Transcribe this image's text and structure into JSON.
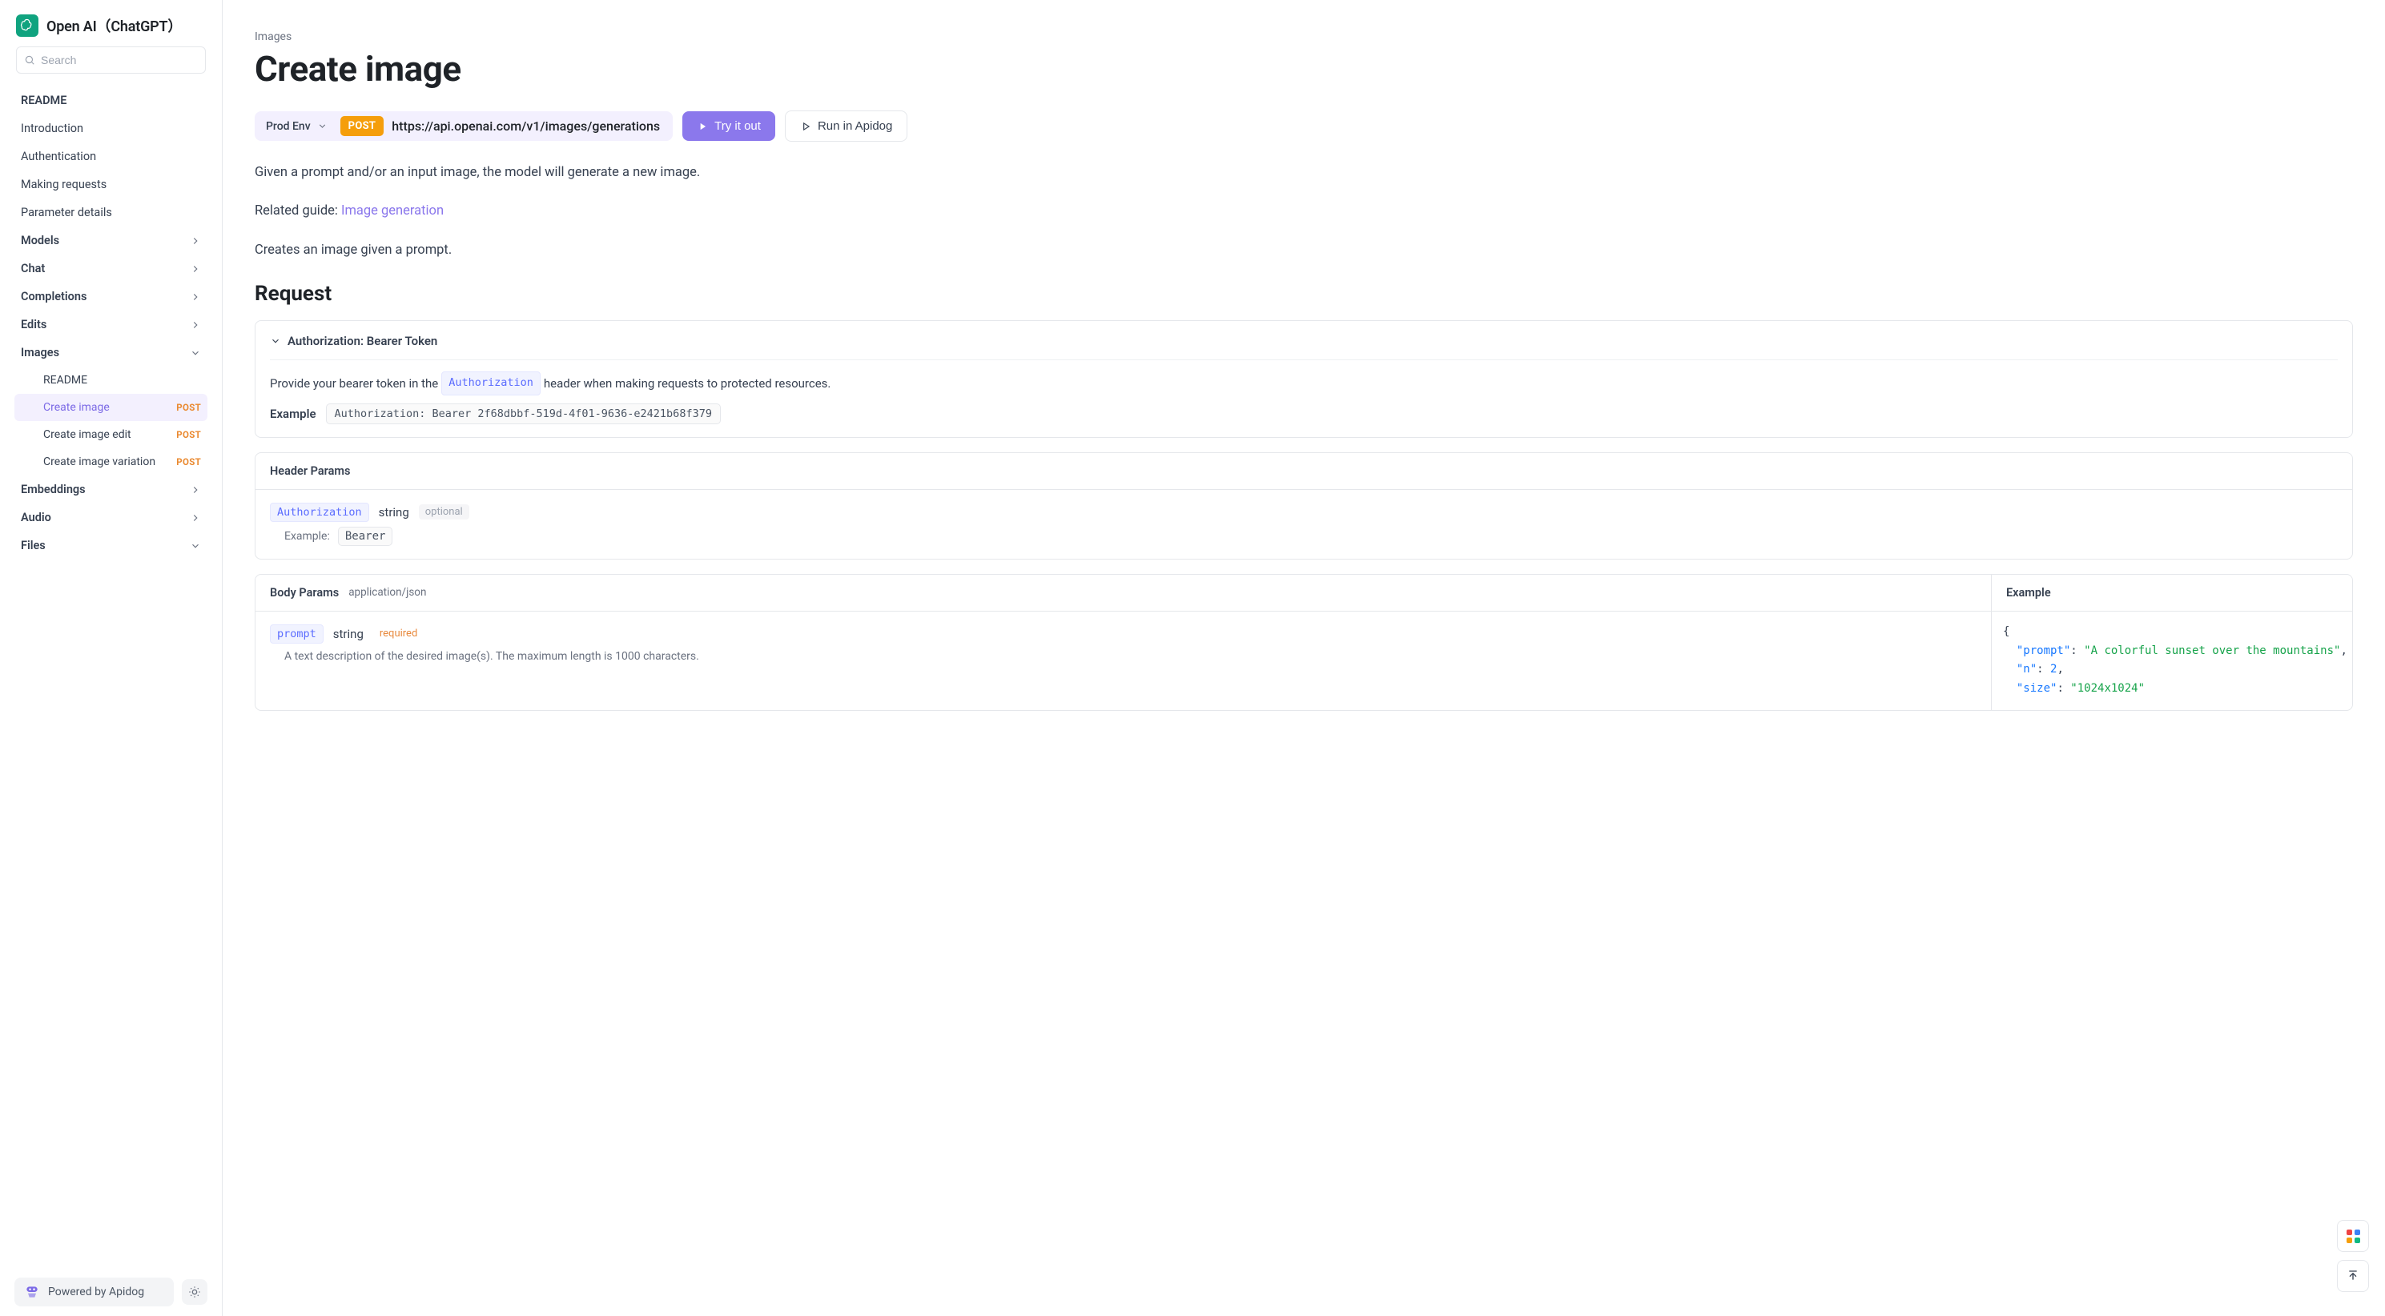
{
  "app": {
    "title": "Open AI（ChatGPT）"
  },
  "search": {
    "placeholder": "Search"
  },
  "sidebar": {
    "items": [
      {
        "label": "README",
        "type": "item"
      },
      {
        "label": "Introduction",
        "type": "item"
      },
      {
        "label": "Authentication",
        "type": "item"
      },
      {
        "label": "Making requests",
        "type": "item"
      },
      {
        "label": "Parameter details",
        "type": "item"
      },
      {
        "label": "Models",
        "type": "group",
        "expanded": false
      },
      {
        "label": "Chat",
        "type": "group",
        "expanded": false
      },
      {
        "label": "Completions",
        "type": "group",
        "expanded": false
      },
      {
        "label": "Edits",
        "type": "group",
        "expanded": false
      },
      {
        "label": "Images",
        "type": "group",
        "expanded": true,
        "children": [
          {
            "label": "README"
          },
          {
            "label": "Create image",
            "tag": "POST",
            "active": true
          },
          {
            "label": "Create image edit",
            "tag": "POST"
          },
          {
            "label": "Create image variation",
            "tag": "POST"
          }
        ]
      },
      {
        "label": "Embeddings",
        "type": "group",
        "expanded": false
      },
      {
        "label": "Audio",
        "type": "group",
        "expanded": false
      },
      {
        "label": "Files",
        "type": "group",
        "expanded": true
      }
    ],
    "footer": "Powered by Apidog"
  },
  "page": {
    "breadcrumb": "Images",
    "title": "Create image",
    "env_label": "Prod Env",
    "method": "POST",
    "url": "https://api.openai.com/v1/images/generations",
    "try_label": "Try it out",
    "run_label": "Run in Apidog",
    "desc1": "Given a prompt and/or an input image, the model will generate a new image.",
    "related_prefix": "Related guide: ",
    "related_link": "Image generation",
    "desc2": "Creates an image given a prompt.",
    "request_heading": "Request"
  },
  "auth": {
    "title": "Authorization: Bearer Token",
    "desc_prefix": "Provide your bearer token in the ",
    "desc_code": "Authorization",
    "desc_suffix": " header when making requests to protected resources.",
    "example_label": "Example",
    "example_value": "Authorization: Bearer 2f68dbbf-519d-4f01-9636-e2421b68f379"
  },
  "header_params": {
    "title": "Header Params",
    "param_name": "Authorization",
    "param_type": "string",
    "param_flag": "optional",
    "example_label": "Example:",
    "example_value": "Bearer "
  },
  "body_params": {
    "title": "Body Params",
    "content_type": "application/json",
    "example_title": "Example",
    "prompt": {
      "name": "prompt",
      "type": "string",
      "flag": "required",
      "desc": "A text description of the desired image(s). The maximum length is 1000 characters."
    }
  },
  "example_json": {
    "prompt": "A colorful sunset over the mountains",
    "n": 2,
    "size": "1024x1024"
  }
}
